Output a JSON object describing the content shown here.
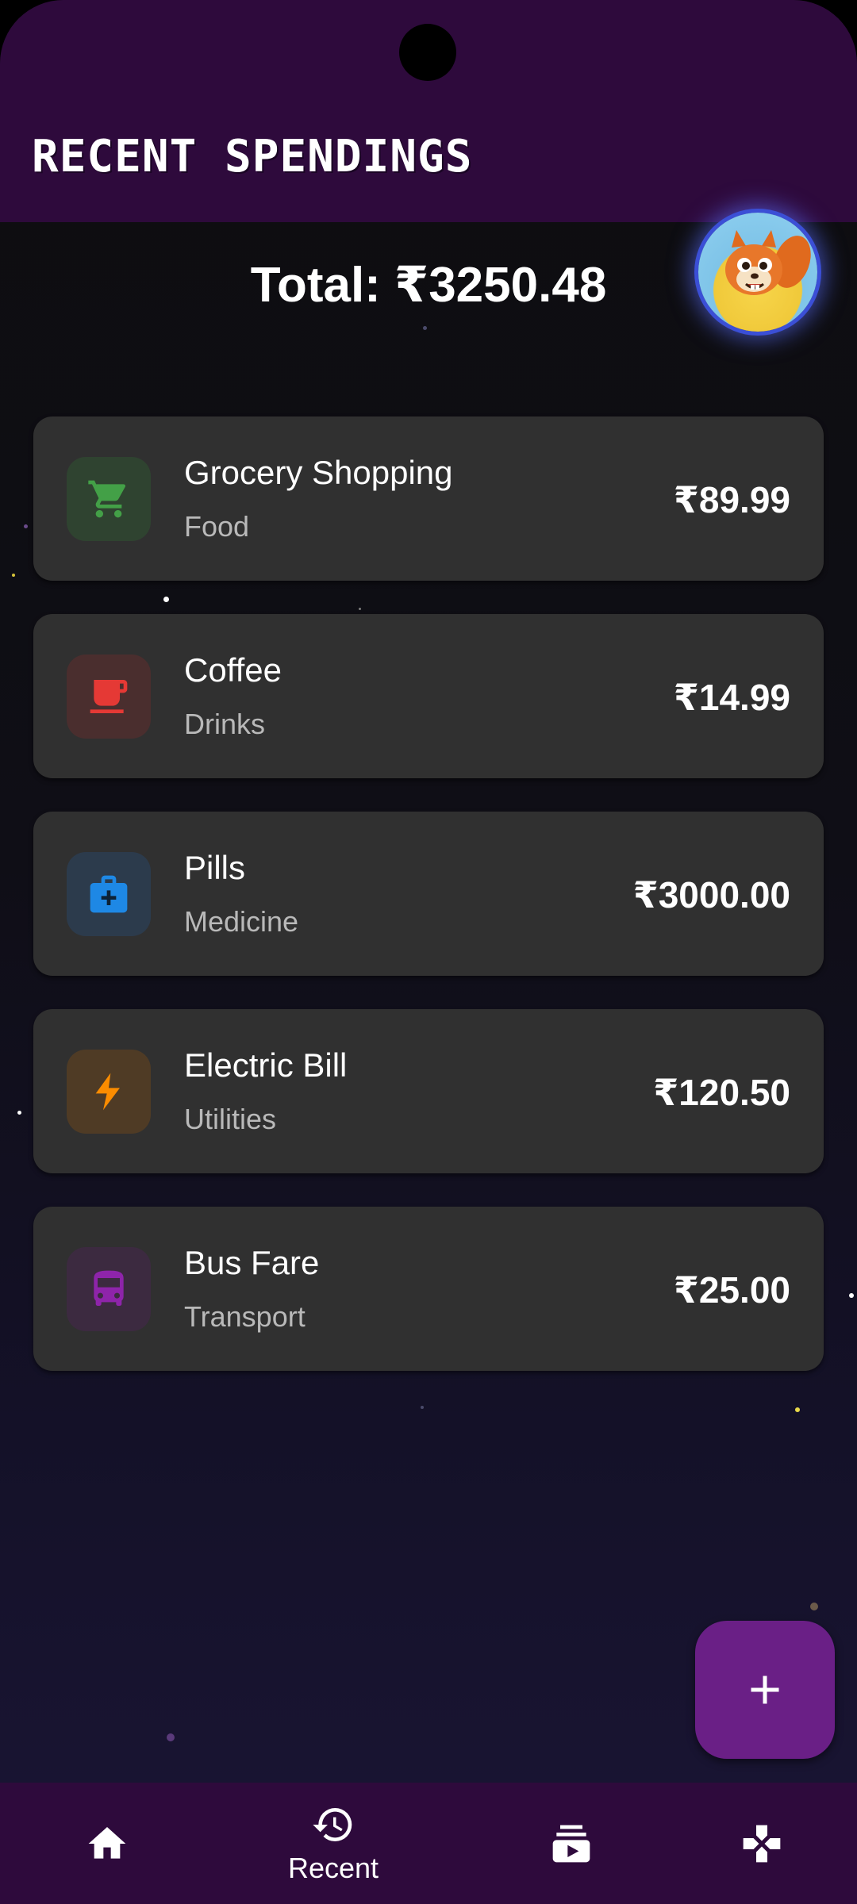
{
  "header": {
    "title": "RECENT SPENDINGS",
    "avatar_icon": "squirrel-mascot-avatar"
  },
  "summary": {
    "total": "Total: ₹3250.48"
  },
  "spendings": [
    {
      "title": "Grocery Shopping",
      "category": "Food",
      "amount": "₹89.99",
      "icon": "cart-icon",
      "color": "#43a047",
      "bg": "#2f4330"
    },
    {
      "title": "Coffee",
      "category": "Drinks",
      "amount": "₹14.99",
      "icon": "coffee-cup-icon",
      "color": "#e53935",
      "bg": "#4a2e2e"
    },
    {
      "title": "Pills",
      "category": "Medicine",
      "amount": "₹3000.00",
      "icon": "medical-kit-icon",
      "color": "#1e88e5",
      "bg": "#2c3b4c"
    },
    {
      "title": "Electric Bill",
      "category": "Utilities",
      "amount": "₹120.50",
      "icon": "lightning-icon",
      "color": "#fb8c00",
      "bg": "#4f3b25"
    },
    {
      "title": "Bus Fare",
      "category": "Transport",
      "amount": "₹25.00",
      "icon": "bus-icon",
      "color": "#8e24aa",
      "bg": "#3c2a40"
    }
  ],
  "fab": {
    "icon": "plus-icon"
  },
  "nav": {
    "items": [
      {
        "icon": "home-icon",
        "label": ""
      },
      {
        "icon": "history-icon",
        "label": "Recent"
      },
      {
        "icon": "subscriptions-icon",
        "label": ""
      },
      {
        "icon": "gamepad-icon",
        "label": ""
      }
    ],
    "active_index": 1
  },
  "colors": {
    "header_bg": "#2e0a3c",
    "card_bg": "#303030",
    "fab_bg": "#6a1f86",
    "accent_glow": "#3b4fd6"
  }
}
